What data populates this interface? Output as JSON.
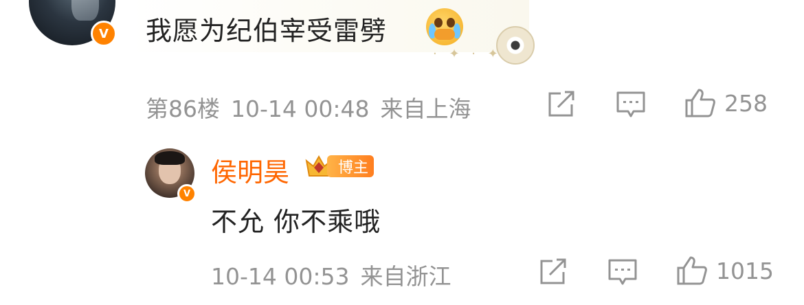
{
  "top_comment": {
    "text": "我愿为纪伯宰受雷劈",
    "emoji": "crying-face-hands-over-mouth",
    "floor": "第86楼",
    "datetime": "10-14 00:48",
    "location": "来自上海",
    "like_count": "258"
  },
  "reply": {
    "author": "侯明昊",
    "role_badge": "博主",
    "text": "不允 你不乘哦",
    "datetime": "10-14 00:53",
    "location": "来自浙江",
    "like_count": "1015"
  },
  "badge_letter": "V",
  "colors": {
    "accent": "#ff8200",
    "name": "#ff6600",
    "meta": "#939393"
  }
}
